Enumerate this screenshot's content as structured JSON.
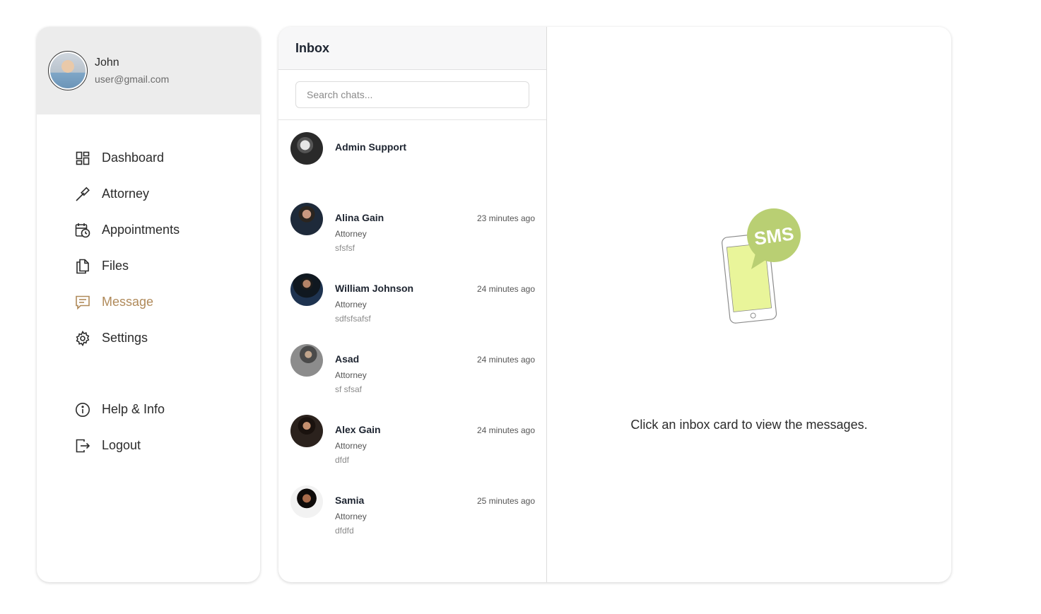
{
  "user": {
    "name": "John",
    "email": "user@gmail.com"
  },
  "nav": {
    "dashboard": "Dashboard",
    "attorney": "Attorney",
    "appointments": "Appointments",
    "files": "Files",
    "message": "Message",
    "settings": "Settings",
    "help": "Help & Info",
    "logout": "Logout"
  },
  "inbox": {
    "title": "Inbox",
    "search_placeholder": "Search chats...",
    "chats": [
      {
        "name": "Admin Support",
        "role": "",
        "message": "",
        "time": ""
      },
      {
        "name": "Alina Gain",
        "role": "Attorney",
        "message": "sfsfsf",
        "time": "23 minutes ago"
      },
      {
        "name": "William Johnson",
        "role": "Attorney",
        "message": "sdfsfsafsf",
        "time": "24 minutes ago"
      },
      {
        "name": "Asad",
        "role": "Attorney",
        "message": "sf sfsaf",
        "time": "24 minutes ago"
      },
      {
        "name": "Alex Gain",
        "role": "Attorney",
        "message": "dfdf",
        "time": "24 minutes ago"
      },
      {
        "name": "Samia",
        "role": "Attorney",
        "message": "dfdfd",
        "time": "25 minutes ago"
      }
    ]
  },
  "view": {
    "hint": "Click an inbox card to view the messages.",
    "illustration_text": "SMS"
  },
  "colors": {
    "accent": "#b08a5a",
    "sms_bubble": "#b9cf73",
    "phone_screen": "#e9f59a"
  }
}
